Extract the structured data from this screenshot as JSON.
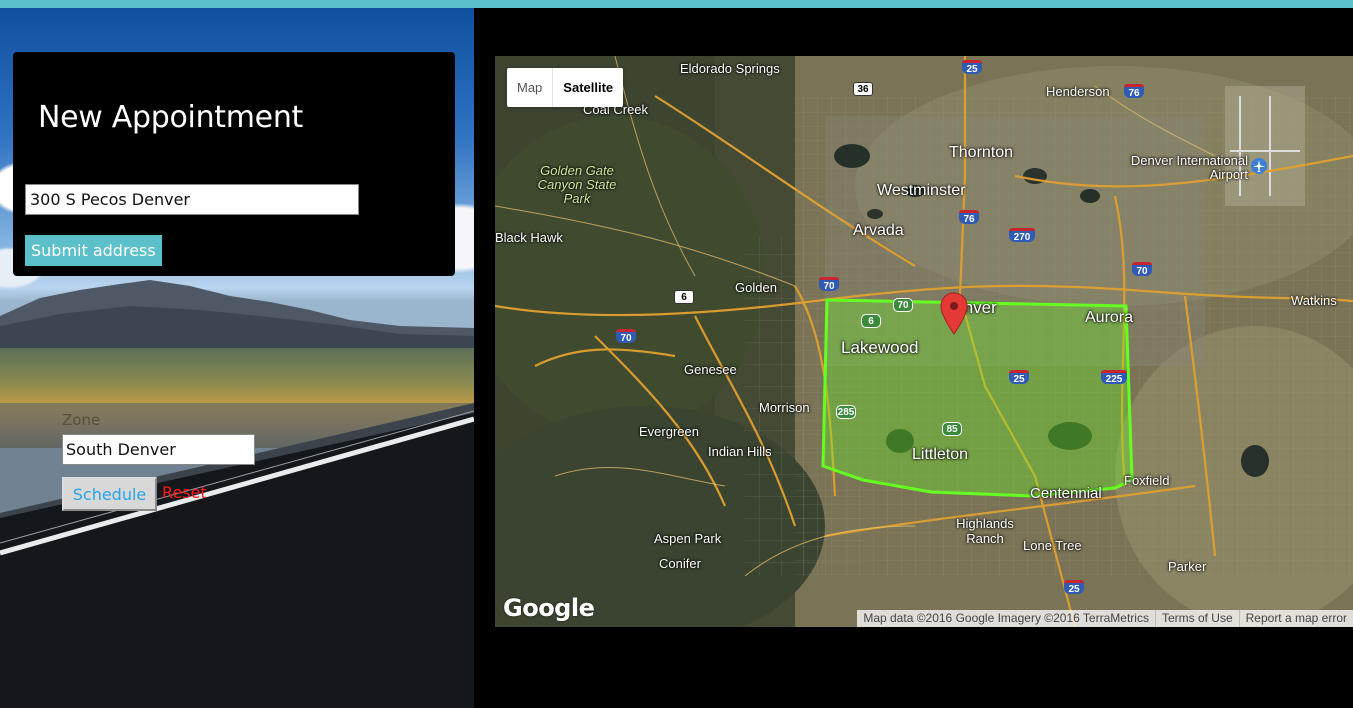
{
  "form": {
    "title": "New Appointment",
    "address_value": "300 S Pecos Denver",
    "submit_label": "Submit address",
    "zone_label": "Zone",
    "zone_value": "South Denver",
    "schedule_label": "Schedule",
    "reset_label": "Reset"
  },
  "map": {
    "type_buttons": [
      "Map",
      "Satellite"
    ],
    "active_type": "Satellite",
    "logo": "Google",
    "attribution": [
      "Map data ©2016 Google Imagery ©2016 TerraMetrics",
      "Terms of Use",
      "Report a map error"
    ],
    "labels": {
      "eldorado": "Eldorado Springs",
      "coal_creek": "Coal Creek",
      "golden_gate": "Golden Gate Canyon State Park",
      "thornton": "Thornton",
      "henderson": "Henderson",
      "denver_airport": "Denver International Airport",
      "westminster": "Westminster",
      "arvada": "Arvada",
      "black_hawk": "Black Hawk",
      "golden": "Golden",
      "denver": "Denver",
      "aurora": "Aurora",
      "watkins": "Watkins",
      "lakewood": "Lakewood",
      "genesee": "Genesee",
      "morrison": "Morrison",
      "evergreen": "Evergreen",
      "indian_hills": "Indian Hills",
      "littleton": "Littleton",
      "centennial": "Centennial",
      "foxfield": "Foxfield",
      "highlands_ranch": "Highlands Ranch",
      "lone_tree": "Lone Tree",
      "aspen_park": "Aspen Park",
      "conifer": "Conifer",
      "parker": "Parker"
    },
    "shields": {
      "i25_top": "25",
      "us36": "36",
      "i76_top": "76",
      "i76_mid": "76",
      "e470": "270",
      "i70_a": "70",
      "i70_b": "70",
      "i70_c": "70",
      "us6_a": "6",
      "us6_b": "6",
      "co70": "70",
      "i25_mid": "25",
      "i225": "225",
      "co285": "285",
      "co85": "85",
      "i25_bottom": "25"
    },
    "zone_color": "#66ff22",
    "pin_color": "#e53935"
  },
  "colors": {
    "accent": "#5bc0c9",
    "reset": "#ff1a1a",
    "schedule_text": "#28a4e8"
  }
}
